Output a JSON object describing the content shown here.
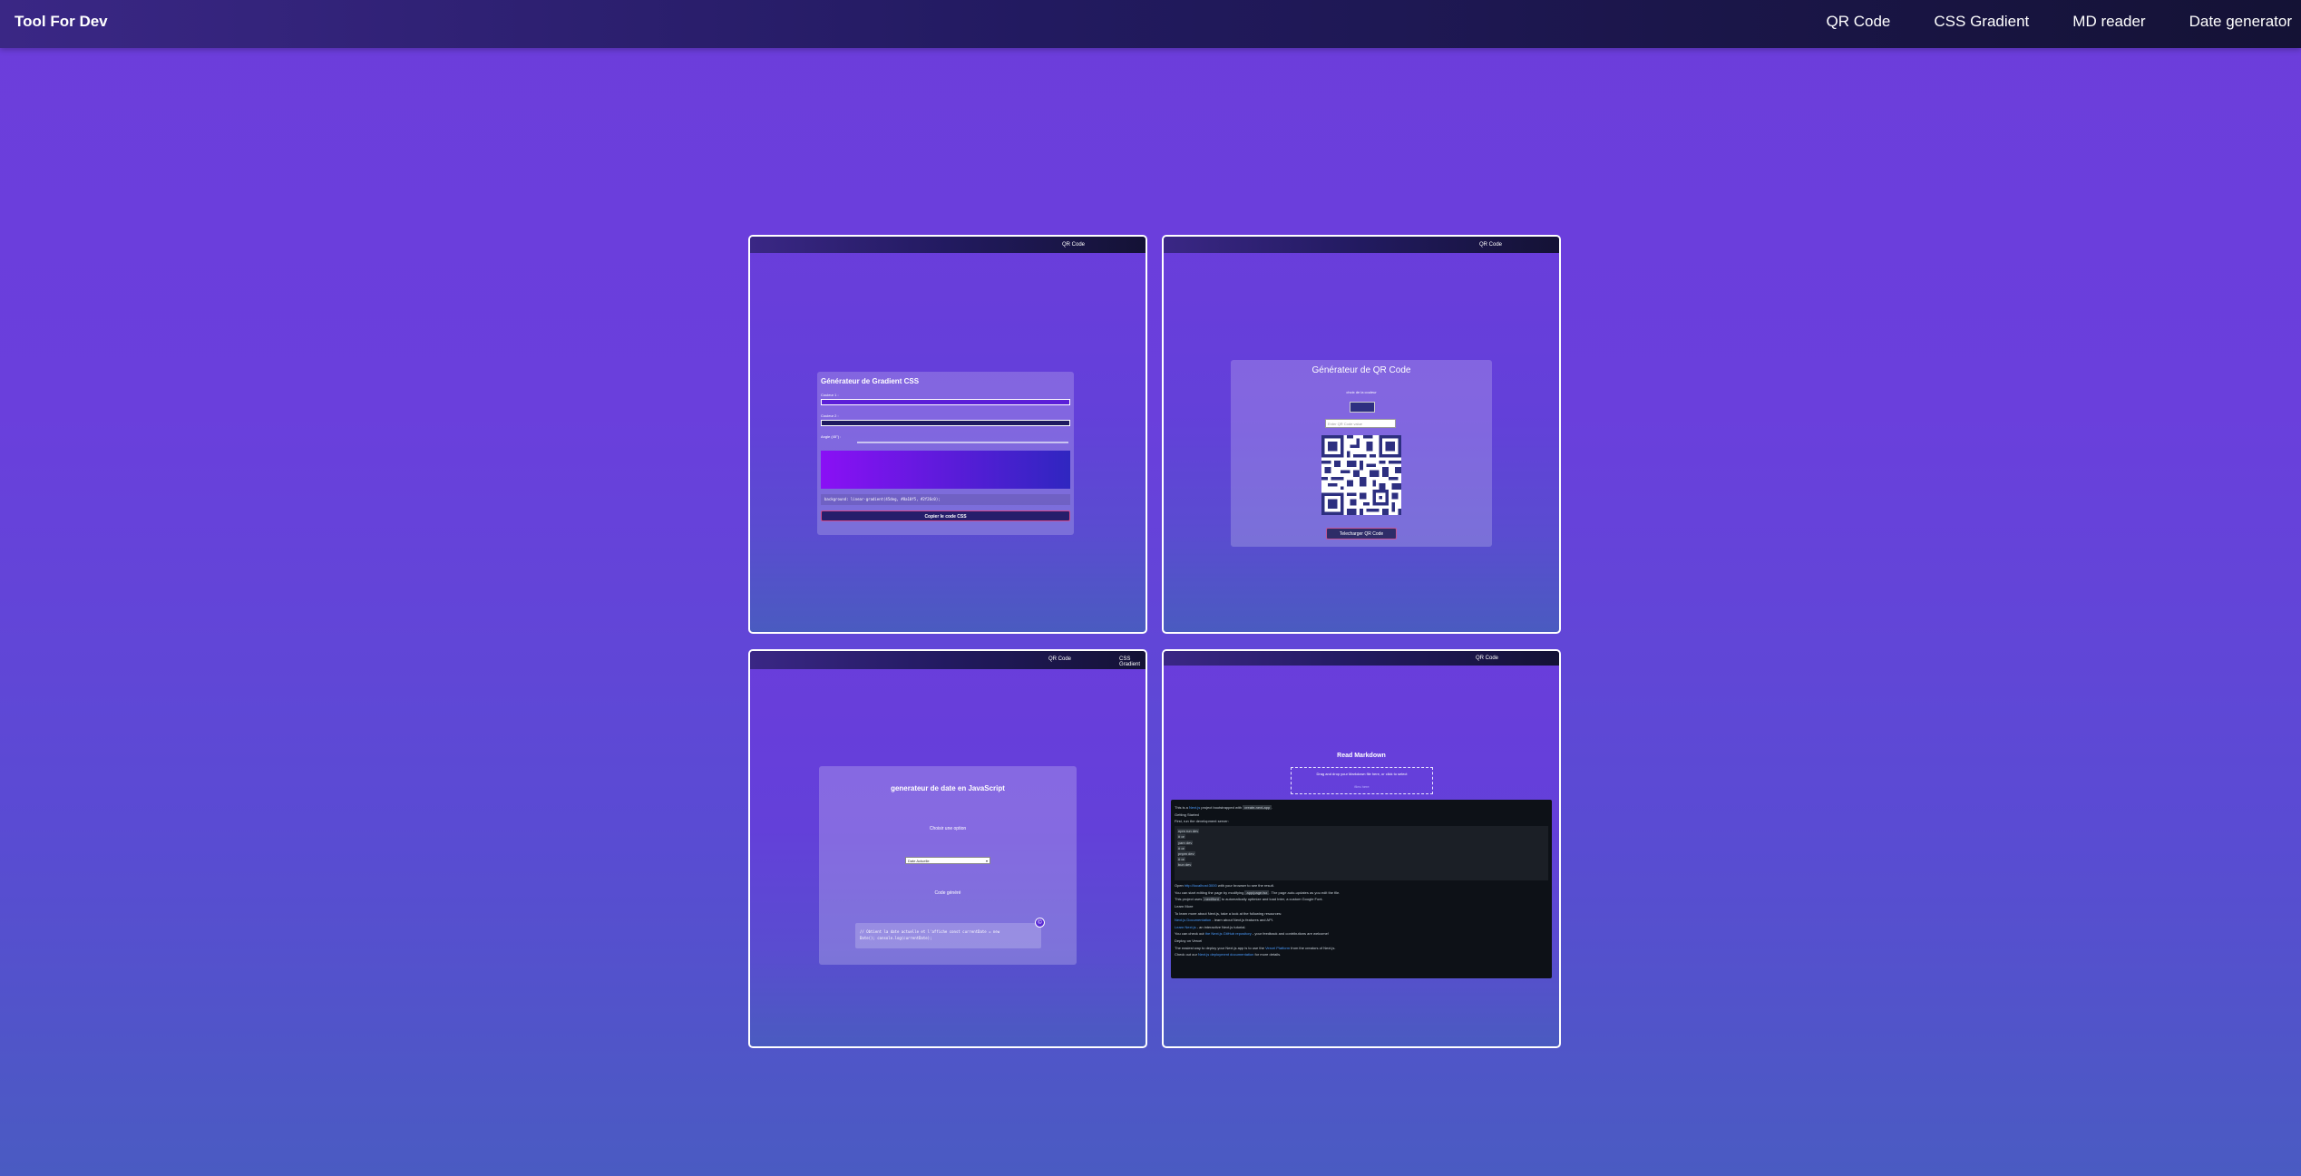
{
  "app": {
    "brand": "Tool For Dev"
  },
  "nav": [
    "QR Code",
    "CSS Gradient",
    "MD reader",
    "Date generator"
  ],
  "cards": {
    "gradient": {
      "nav_label": "QR Code",
      "title": "Générateur de Gradient CSS",
      "color1_label": "Couleur 1 :",
      "color2_label": "Couleur 2 :",
      "angle_label": "Angle (45°) :",
      "css_code": "background: linear-gradient(45deg, #8a10f5, #2f26c0);",
      "copy_button": "Copier le code CSS"
    },
    "qr": {
      "nav_label": "QR Code",
      "title": "Générateur de QR Code",
      "color_label": "choix de la couleur",
      "input_placeholder": "Enter QR Code value",
      "download_button": "Telecharger QR Code"
    },
    "date": {
      "nav_labels": [
        "QR Code",
        "CSS Gradient"
      ],
      "title": "generateur de date en JavaScript",
      "choose_label": "Choisir une option",
      "select_value": "Date Actuelle",
      "generated_label": "Code généré",
      "code_line1": "// Obtient la date actuelle et l'affiche const currentDate = new",
      "code_line2": "Date(); console.log(currentDate);",
      "copy_icon_label": "©"
    },
    "markdown": {
      "nav_label": "QR Code",
      "title": "Read Markdown",
      "drop_text": "Drag and drop your Markdown file here, or click to select",
      "drop_sub": "files here",
      "doc": {
        "intro_pre": "This is a ",
        "intro_link": "Next.js",
        "intro_mid": " project bootstrapped with ",
        "intro_code": "create-next-app",
        "intro_end": ".",
        "getting_started": "Getting Started",
        "first_run": "First, run the development server:",
        "commands": [
          "npm run dev",
          "# or",
          "yarn dev",
          "# or",
          "pnpm dev",
          "# or",
          "bun dev"
        ],
        "open_pre": "Open ",
        "open_link": "http://localhost:3000",
        "open_post": " with your browser to see the result.",
        "edit_pre": "You can start editing the page by modifying ",
        "edit_code": "app/page.tsx",
        "edit_post": ". The page auto-updates as you edit the file.",
        "font_pre": "This project uses ",
        "font_code": "next/font",
        "font_post": " to automatically optimize and load Inter, a custom Google Font.",
        "learn_more": "Learn More",
        "learn_intro": "To learn more about Next.js, take a look at the following resources:",
        "docs_link": "Next.js Documentation",
        "docs_post": " - learn about Next.js features and API.",
        "learn_link": "Learn Next.js",
        "learn_post": " - an interactive Next.js tutorial.",
        "github_pre": "You can check out ",
        "github_link": "the Next.js GitHub repository",
        "github_post": " - your feedback and contributions are welcome!",
        "deploy_title": "Deploy on Vercel",
        "deploy_pre": "The easiest way to deploy your Next.js app is to use the ",
        "deploy_link": "Vercel Platform",
        "deploy_post": " from the creators of Next.js.",
        "check_pre": "Check out our ",
        "check_link": "Next.js deployment documentation",
        "check_post": " for more details."
      }
    }
  }
}
